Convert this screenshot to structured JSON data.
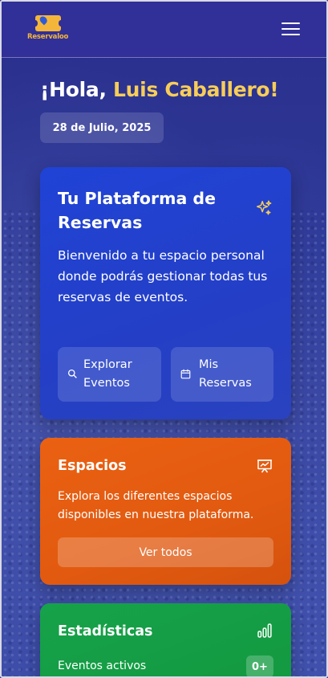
{
  "header": {
    "logo_text": "Reservaloo",
    "menu_icon": "hamburger-menu-icon"
  },
  "greeting": {
    "prefix": "¡Hola, ",
    "name": "Luis Caballero!",
    "date": "28 de Julio, 2025"
  },
  "platform_card": {
    "title": "Tu Plataforma de Reservas",
    "icon": "sparkles-icon",
    "description": "Bienvenido a tu espacio personal donde podrás gestionar todas tus reservas de eventos.",
    "actions": [
      {
        "label": "Explorar Eventos",
        "icon": "search-icon"
      },
      {
        "label": "Mis Reservas",
        "icon": "calendar-icon"
      }
    ]
  },
  "spaces_card": {
    "title": "Espacios",
    "icon": "presentation-icon",
    "description": "Explora los diferentes espacios disponibles en nuestra plataforma.",
    "button_label": "Ver todos"
  },
  "stats_card": {
    "title": "Estadísticas",
    "icon": "bar-chart-icon",
    "items": [
      {
        "label": "Eventos activos",
        "value": "0+"
      }
    ]
  },
  "colors": {
    "header": "#312f98",
    "accent_name": "#f7cd59",
    "platform_card": "#2043d6",
    "spaces_card": "#ea6112",
    "stats_card": "#16a24a"
  }
}
